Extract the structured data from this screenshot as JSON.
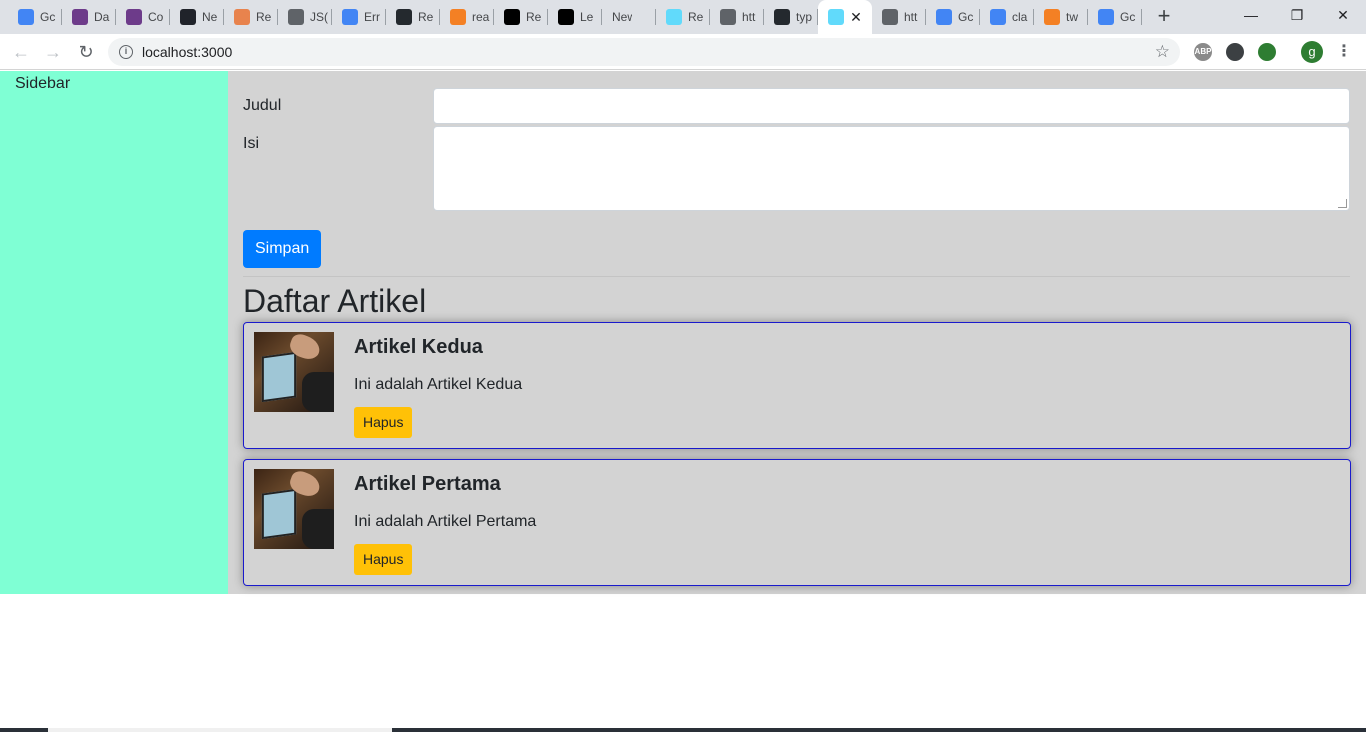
{
  "browser": {
    "tabs": [
      {
        "label": "Gc",
        "icon": "google-icon",
        "color": "#4285f4"
      },
      {
        "label": "Da",
        "icon": "university-icon",
        "color": "#6d3b8a"
      },
      {
        "label": "Co",
        "icon": "university-icon",
        "color": "#6d3b8a"
      },
      {
        "label": "Ne",
        "icon": "react-icon",
        "color": "#20232a"
      },
      {
        "label": "Re",
        "icon": "rainbow-icon",
        "color": "#e8834d"
      },
      {
        "label": "JS(",
        "icon": "code-icon",
        "color": "#5f6368"
      },
      {
        "label": "Err",
        "icon": "google-icon",
        "color": "#4285f4"
      },
      {
        "label": "Re",
        "icon": "github-icon",
        "color": "#24292e"
      },
      {
        "label": "rea",
        "icon": "stackoverflow-icon",
        "color": "#f48024"
      },
      {
        "label": "Re",
        "icon": "nextjs-icon",
        "color": "#000000"
      },
      {
        "label": "Le",
        "icon": "nextjs-icon",
        "color": "#000000"
      },
      {
        "label": "New Ta",
        "icon": "",
        "color": ""
      },
      {
        "label": "Re",
        "icon": "react-icon",
        "color": "#61dafb"
      },
      {
        "label": "htt",
        "icon": "code-icon",
        "color": "#5f6368"
      },
      {
        "label": "typ",
        "icon": "github-icon",
        "color": "#24292e"
      },
      {
        "label": "",
        "icon": "react-icon",
        "color": "#61dafb",
        "active": true
      },
      {
        "label": "htt",
        "icon": "code-icon",
        "color": "#5f6368"
      },
      {
        "label": "Gc",
        "icon": "google-icon",
        "color": "#4285f4"
      },
      {
        "label": "cla",
        "icon": "google-icon",
        "color": "#4285f4"
      },
      {
        "label": "tw",
        "icon": "stackoverflow-icon",
        "color": "#f48024"
      },
      {
        "label": "Gc",
        "icon": "google-translate-icon",
        "color": "#4285f4"
      }
    ],
    "url": "localhost:3000",
    "profile_initial": "g",
    "extensions": [
      {
        "name": "adblock-icon",
        "label": "ABP",
        "color": "#8a8a8a"
      },
      {
        "name": "screen-capture-icon",
        "label": "",
        "color": "#3c4043"
      },
      {
        "name": "globe-extension-icon",
        "label": "",
        "color": "#2e7d32"
      }
    ]
  },
  "page": {
    "sidebar": {
      "label": "Sidebar"
    },
    "form": {
      "title_label": "Judul",
      "title_value": "",
      "body_label": "Isi",
      "body_value": "",
      "submit_label": "Simpan"
    },
    "list_heading": "Daftar Artikel",
    "articles": [
      {
        "title": "Artikel Kedua",
        "body": "Ini adalah Artikel Kedua",
        "delete_label": "Hapus"
      },
      {
        "title": "Artikel Pertama",
        "body": "Ini adalah Artikel Pertama",
        "delete_label": "Hapus"
      }
    ]
  },
  "colors": {
    "sidebar_bg": "#7fffd4",
    "main_bg": "#d3d3d3",
    "primary": "#007bff",
    "warning": "#ffc107",
    "card_border": "#1a1acc"
  }
}
